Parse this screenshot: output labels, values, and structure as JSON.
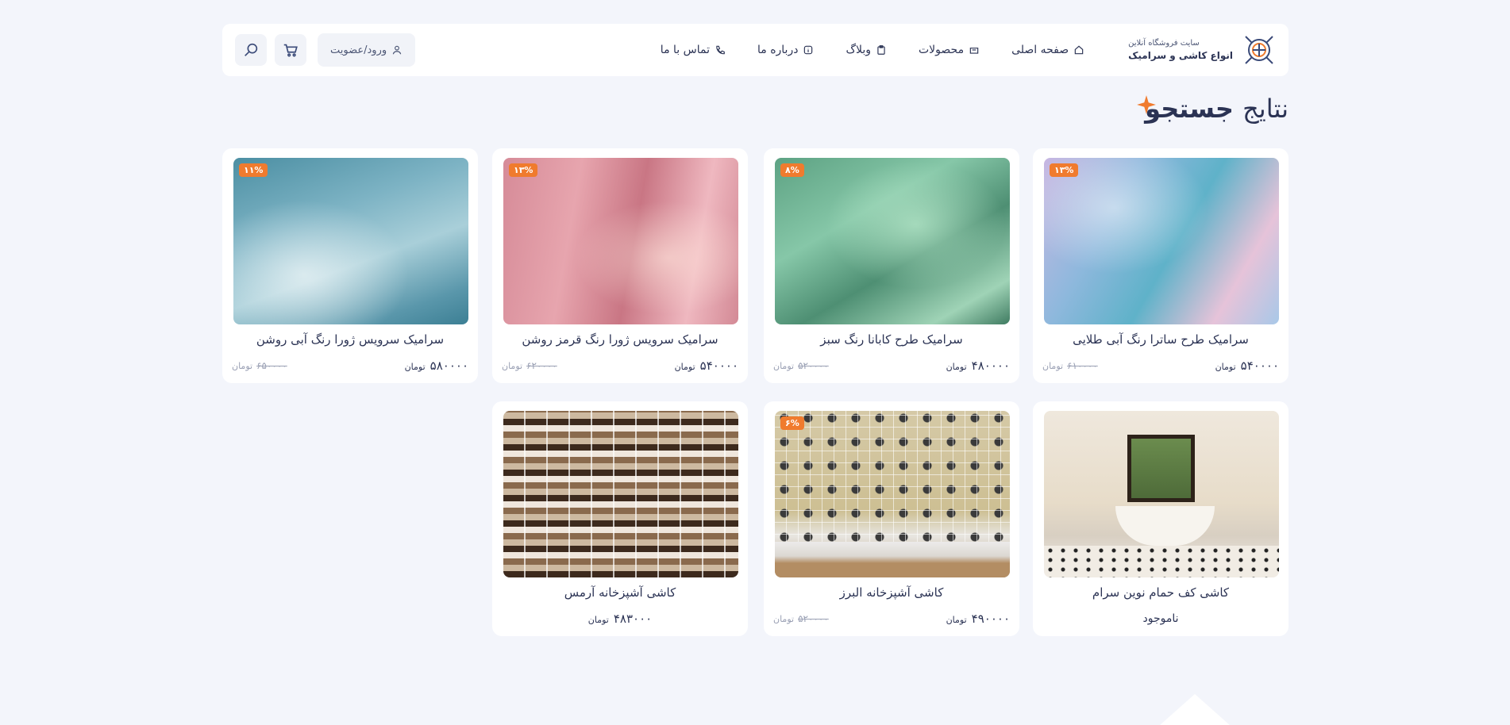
{
  "header": {
    "brand": {
      "subtitle": "سایت فروشگاه آنلاین",
      "title": "انواع کاشی و سرامیک"
    },
    "nav": [
      {
        "label": "صفحه اصلی",
        "icon": "home-icon"
      },
      {
        "label": "محصولات",
        "icon": "box-icon"
      },
      {
        "label": "وبلاگ",
        "icon": "clipboard-icon"
      },
      {
        "label": "درباره ما",
        "icon": "info-icon"
      },
      {
        "label": "تماس با ما",
        "icon": "phone-icon"
      }
    ],
    "login_label": "ورود/عضویت",
    "cart_icon": "cart-icon",
    "search_icon": "search-icon"
  },
  "page": {
    "title_bold": "جستجو",
    "title_light": "نتایج"
  },
  "currency": "تومان",
  "products": [
    {
      "title": "سرامیک طرح ساترا رنگ آبی طلایی",
      "price": "۵۴۰۰۰۰",
      "old_price": "۶۱۰۰۰۰",
      "discount": "۱۳%"
    },
    {
      "title": "سرامیک طرح کابانا رنگ سبز",
      "price": "۴۸۰۰۰۰",
      "old_price": "۵۲۰۰۰۰",
      "discount": "۸%"
    },
    {
      "title": "سرامیک سرویس ژورا رنگ قرمز روشن",
      "price": "۵۴۰۰۰۰",
      "old_price": "۶۲۰۰۰۰",
      "discount": "۱۳%"
    },
    {
      "title": "سرامیک سرویس ژورا رنگ آبی روشن",
      "price": "۵۸۰۰۰۰",
      "old_price": "۶۵۰۰۰۰",
      "discount": "۱۱%"
    },
    {
      "title": "کاشی کف حمام نوین سرام",
      "status": "ناموجود"
    },
    {
      "title": "کاشی آشپزخانه البرز",
      "price": "۴۹۰۰۰۰",
      "old_price": "۵۲۰۰۰۰",
      "discount": "۶%"
    },
    {
      "title": "کاشی آشپزخانه آرمس",
      "price": "۴۸۳۰۰۰"
    }
  ],
  "colors": {
    "accent": "#f07b2e",
    "text": "#2b3354",
    "background": "#f3f5fb"
  }
}
